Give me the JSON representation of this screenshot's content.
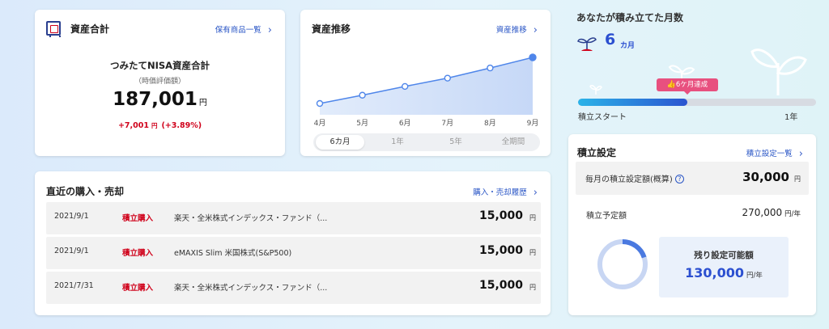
{
  "total": {
    "title": "資産合計",
    "link": "保有商品一覧",
    "heading": "つみたてNISA資産合計",
    "subheading": "（時価評価額）",
    "amount": "187,001",
    "yen": "円",
    "change": "+7,001",
    "change_yen": "円",
    "change_pct": "(+3.89%)"
  },
  "trend": {
    "title": "資産推移",
    "link": "資産推移",
    "periods": [
      "6カ月",
      "1年",
      "5年",
      "全期間"
    ],
    "active_period": 0,
    "chart_data": {
      "type": "area",
      "categories": [
        "4月",
        "5月",
        "6月",
        "7月",
        "8月",
        "9月"
      ],
      "values": [
        0.0,
        0.18,
        0.37,
        0.55,
        0.77,
        1.0
      ],
      "title": "",
      "xlabel": "",
      "ylabel": "",
      "grid": false,
      "colors": {
        "line": "#4f86ea",
        "fill": "#c6d8f7"
      }
    }
  },
  "recent": {
    "title": "直近の購入・売却",
    "link": "購入・売却履歴",
    "rows": [
      {
        "date": "2021/9/1",
        "type": "積立購入",
        "fund": "楽天・全米株式インデックス・ファンド（...",
        "amount": "15,000",
        "yen": "円"
      },
      {
        "date": "2021/9/1",
        "type": "積立購入",
        "fund": "eMAXIS Slim 米国株式(S&P500)",
        "amount": "15,000",
        "yen": "円"
      },
      {
        "date": "2021/7/31",
        "type": "積立購入",
        "fund": "楽天・全米株式インデックス・ファンド（...",
        "amount": "15,000",
        "yen": "円"
      }
    ]
  },
  "months": {
    "title": "あなたが積み立てた月数",
    "count": "6",
    "unit": "カ月",
    "badge": "6ケ月達成",
    "progress_fraction": 0.46,
    "start_label": "積立スタート",
    "end_label": "1年"
  },
  "settings": {
    "title": "積立設定",
    "link": "積立設定一覧",
    "monthly_label": "毎月の積立設定額(概算)",
    "monthly_amount": "30,000",
    "monthly_yen": "円",
    "planned_label": "積立予定額",
    "planned_amount": "270,000",
    "planned_unit": "円/年",
    "remaining_label": "残り設定可能額",
    "remaining_amount": "130,000",
    "remaining_unit": "円/年",
    "used_fraction": 0.2
  },
  "colors": {
    "accent": "#2b4fd0",
    "negative_red": "#d0021b",
    "badge_pink": "#e8507f"
  }
}
